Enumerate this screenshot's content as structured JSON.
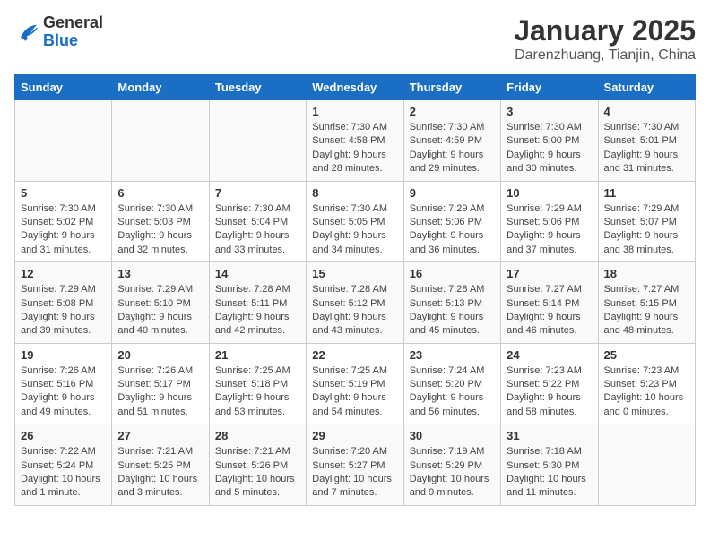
{
  "header": {
    "logo_general": "General",
    "logo_blue": "Blue",
    "title": "January 2025",
    "subtitle": "Darenzhuang, Tianjin, China"
  },
  "weekdays": [
    "Sunday",
    "Monday",
    "Tuesday",
    "Wednesday",
    "Thursday",
    "Friday",
    "Saturday"
  ],
  "weeks": [
    [
      {
        "day": "",
        "info": ""
      },
      {
        "day": "",
        "info": ""
      },
      {
        "day": "",
        "info": ""
      },
      {
        "day": "1",
        "info": "Sunrise: 7:30 AM\nSunset: 4:58 PM\nDaylight: 9 hours\nand 28 minutes."
      },
      {
        "day": "2",
        "info": "Sunrise: 7:30 AM\nSunset: 4:59 PM\nDaylight: 9 hours\nand 29 minutes."
      },
      {
        "day": "3",
        "info": "Sunrise: 7:30 AM\nSunset: 5:00 PM\nDaylight: 9 hours\nand 30 minutes."
      },
      {
        "day": "4",
        "info": "Sunrise: 7:30 AM\nSunset: 5:01 PM\nDaylight: 9 hours\nand 31 minutes."
      }
    ],
    [
      {
        "day": "5",
        "info": "Sunrise: 7:30 AM\nSunset: 5:02 PM\nDaylight: 9 hours\nand 31 minutes."
      },
      {
        "day": "6",
        "info": "Sunrise: 7:30 AM\nSunset: 5:03 PM\nDaylight: 9 hours\nand 32 minutes."
      },
      {
        "day": "7",
        "info": "Sunrise: 7:30 AM\nSunset: 5:04 PM\nDaylight: 9 hours\nand 33 minutes."
      },
      {
        "day": "8",
        "info": "Sunrise: 7:30 AM\nSunset: 5:05 PM\nDaylight: 9 hours\nand 34 minutes."
      },
      {
        "day": "9",
        "info": "Sunrise: 7:29 AM\nSunset: 5:06 PM\nDaylight: 9 hours\nand 36 minutes."
      },
      {
        "day": "10",
        "info": "Sunrise: 7:29 AM\nSunset: 5:06 PM\nDaylight: 9 hours\nand 37 minutes."
      },
      {
        "day": "11",
        "info": "Sunrise: 7:29 AM\nSunset: 5:07 PM\nDaylight: 9 hours\nand 38 minutes."
      }
    ],
    [
      {
        "day": "12",
        "info": "Sunrise: 7:29 AM\nSunset: 5:08 PM\nDaylight: 9 hours\nand 39 minutes."
      },
      {
        "day": "13",
        "info": "Sunrise: 7:29 AM\nSunset: 5:10 PM\nDaylight: 9 hours\nand 40 minutes."
      },
      {
        "day": "14",
        "info": "Sunrise: 7:28 AM\nSunset: 5:11 PM\nDaylight: 9 hours\nand 42 minutes."
      },
      {
        "day": "15",
        "info": "Sunrise: 7:28 AM\nSunset: 5:12 PM\nDaylight: 9 hours\nand 43 minutes."
      },
      {
        "day": "16",
        "info": "Sunrise: 7:28 AM\nSunset: 5:13 PM\nDaylight: 9 hours\nand 45 minutes."
      },
      {
        "day": "17",
        "info": "Sunrise: 7:27 AM\nSunset: 5:14 PM\nDaylight: 9 hours\nand 46 minutes."
      },
      {
        "day": "18",
        "info": "Sunrise: 7:27 AM\nSunset: 5:15 PM\nDaylight: 9 hours\nand 48 minutes."
      }
    ],
    [
      {
        "day": "19",
        "info": "Sunrise: 7:26 AM\nSunset: 5:16 PM\nDaylight: 9 hours\nand 49 minutes."
      },
      {
        "day": "20",
        "info": "Sunrise: 7:26 AM\nSunset: 5:17 PM\nDaylight: 9 hours\nand 51 minutes."
      },
      {
        "day": "21",
        "info": "Sunrise: 7:25 AM\nSunset: 5:18 PM\nDaylight: 9 hours\nand 53 minutes."
      },
      {
        "day": "22",
        "info": "Sunrise: 7:25 AM\nSunset: 5:19 PM\nDaylight: 9 hours\nand 54 minutes."
      },
      {
        "day": "23",
        "info": "Sunrise: 7:24 AM\nSunset: 5:20 PM\nDaylight: 9 hours\nand 56 minutes."
      },
      {
        "day": "24",
        "info": "Sunrise: 7:23 AM\nSunset: 5:22 PM\nDaylight: 9 hours\nand 58 minutes."
      },
      {
        "day": "25",
        "info": "Sunrise: 7:23 AM\nSunset: 5:23 PM\nDaylight: 10 hours\nand 0 minutes."
      }
    ],
    [
      {
        "day": "26",
        "info": "Sunrise: 7:22 AM\nSunset: 5:24 PM\nDaylight: 10 hours\nand 1 minute."
      },
      {
        "day": "27",
        "info": "Sunrise: 7:21 AM\nSunset: 5:25 PM\nDaylight: 10 hours\nand 3 minutes."
      },
      {
        "day": "28",
        "info": "Sunrise: 7:21 AM\nSunset: 5:26 PM\nDaylight: 10 hours\nand 5 minutes."
      },
      {
        "day": "29",
        "info": "Sunrise: 7:20 AM\nSunset: 5:27 PM\nDaylight: 10 hours\nand 7 minutes."
      },
      {
        "day": "30",
        "info": "Sunrise: 7:19 AM\nSunset: 5:29 PM\nDaylight: 10 hours\nand 9 minutes."
      },
      {
        "day": "31",
        "info": "Sunrise: 7:18 AM\nSunset: 5:30 PM\nDaylight: 10 hours\nand 11 minutes."
      },
      {
        "day": "",
        "info": ""
      }
    ]
  ]
}
